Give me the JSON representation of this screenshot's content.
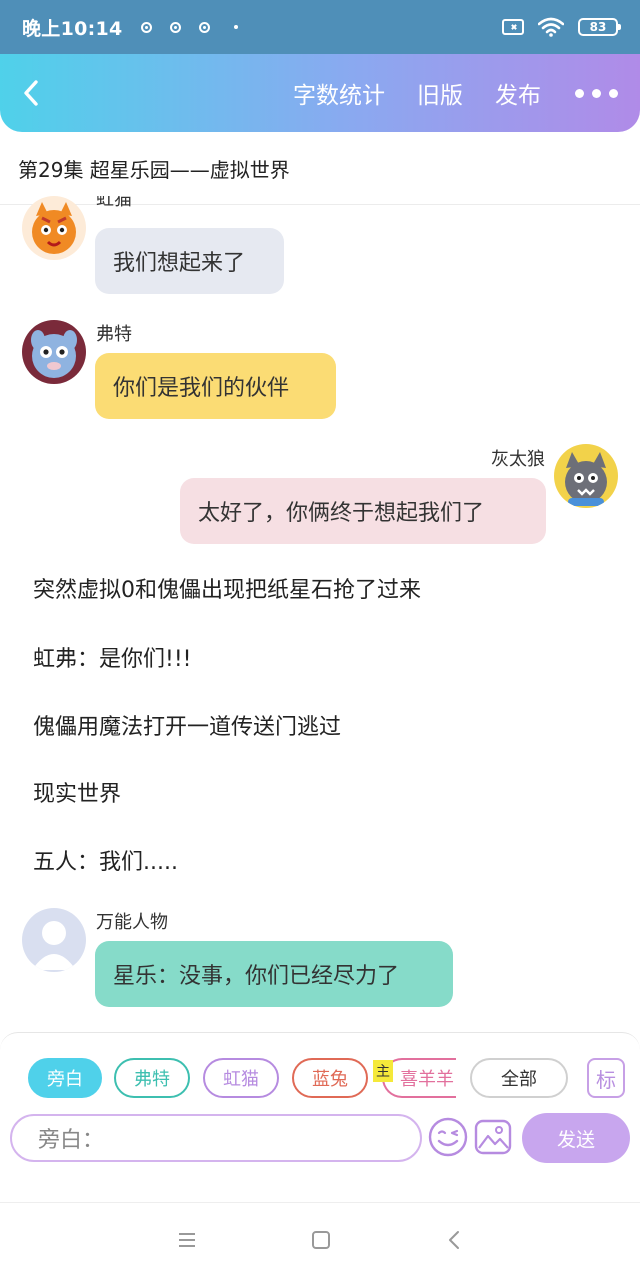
{
  "status_bar": {
    "time": "晚上10:14",
    "battery": "83"
  },
  "app_bar": {
    "actions": [
      "字数统计",
      "旧版",
      "发布"
    ]
  },
  "episode_title": "第29集  超星乐园——虚拟世界",
  "messages": [
    {
      "name": "虹猫",
      "text": "我们想起来了",
      "bubble_color": "#e6e9f1"
    },
    {
      "name": "弗特",
      "text": "你们是我们的伙伴",
      "bubble_color": "#fbdc74"
    },
    {
      "name": "灰太狼",
      "text": "太好了，你俩终于想起我们了",
      "bubble_color": "#f6dfe3"
    },
    {
      "name": "万能人物",
      "text": "星乐：没事，你们已经尽力了",
      "bubble_color": "#86dbc9"
    }
  ],
  "narration": [
    "突然虚拟0和傀儡出现把纸星石抢了过来",
    "虹弗：是你们!!!",
    "傀儡用魔法打开一道传送门逃过",
    "现实世界",
    "五人：我们....."
  ],
  "role_chips": [
    {
      "label": "旁白",
      "color": "#4fd1ea",
      "active": true
    },
    {
      "label": "弗特",
      "color": "#3dbfb0",
      "active": false
    },
    {
      "label": "虹猫",
      "color": "#b68be0",
      "active": false
    },
    {
      "label": "蓝兔",
      "color": "#e06a56",
      "active": false
    },
    {
      "label": "喜羊羊",
      "color": "#e2709d",
      "active": false
    },
    {
      "label": "全部",
      "color": "#d0d0d0",
      "active": false
    }
  ],
  "role_chip_tag": "主",
  "mark_button": "标",
  "input": {
    "placeholder": "旁白："
  },
  "send_label": "发送"
}
